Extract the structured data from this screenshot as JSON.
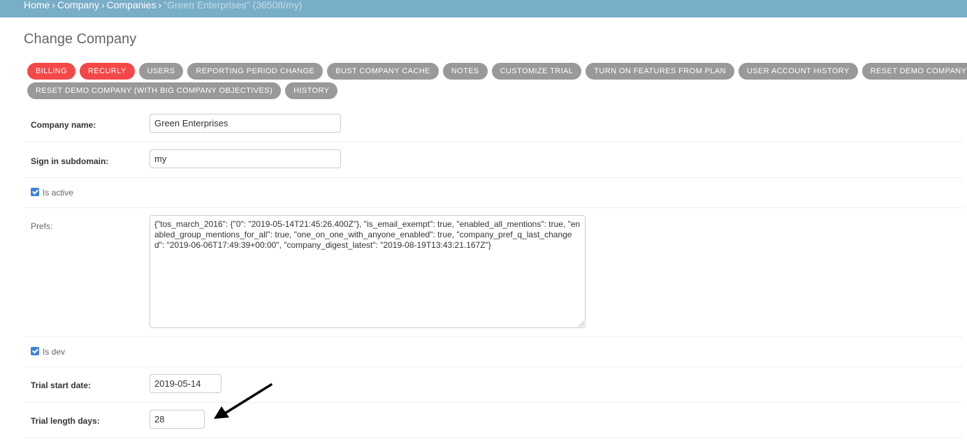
{
  "breadcrumbs": {
    "items": [
      "Home",
      "Company",
      "Companies"
    ],
    "separator": "›",
    "current": "\"Green Enterprises\" (36508/my)"
  },
  "page_title": "Change Company",
  "toolbar": {
    "row1": [
      {
        "label": "BILLING",
        "color": "#f44848"
      },
      {
        "label": "RECURLY",
        "color": "#f44848"
      },
      {
        "label": "USERS",
        "color": "#999999"
      },
      {
        "label": "REPORTING PERIOD CHANGE",
        "color": "#999999"
      },
      {
        "label": "BUST COMPANY CACHE",
        "color": "#999999"
      },
      {
        "label": "NOTES",
        "color": "#999999"
      },
      {
        "label": "CUSTOMIZE TRIAL",
        "color": "#999999"
      },
      {
        "label": "TURN ON FEATURES FROM PLAN",
        "color": "#999999"
      },
      {
        "label": "USER ACCOUNT HISTORY",
        "color": "#999999"
      },
      {
        "label": "RESET DEMO COMPANY",
        "color": "#999999"
      }
    ],
    "row2": [
      {
        "label": "RESET DEMO COMPANY (WITH BIG COMPANY OBJECTIVES)",
        "color": "#999999"
      },
      {
        "label": "HISTORY",
        "color": "#999999"
      }
    ]
  },
  "form": {
    "company_name": {
      "label": "Company name:",
      "value": "Green Enterprises"
    },
    "subdomain": {
      "label": "Sign in subdomain:",
      "value": "my"
    },
    "is_active": {
      "label": "Is active",
      "checked": true
    },
    "prefs": {
      "label": "Prefs:",
      "value": "{\"tos_march_2016\": {\"0\": \"2019-05-14T21:45:26.400Z\"}, \"is_email_exempt\": true, \"enabled_all_mentions\": true, \"enabled_group_mentions_for_all\": true, \"one_on_one_with_anyone_enabled\": true, \"company_pref_q_last_changed\": \"2019-06-06T17:49:39+00:00\", \"company_digest_latest\": \"2019-08-19T13:43:21.167Z\"}"
    },
    "is_dev": {
      "label": "Is dev",
      "checked": true
    },
    "trial_start": {
      "label": "Trial start date:",
      "value": "2019-05-14"
    },
    "trial_length": {
      "label": "Trial length days:",
      "value": "28"
    }
  },
  "annotation": {
    "icon": "arrow-annotation-icon",
    "color": "#000000"
  }
}
